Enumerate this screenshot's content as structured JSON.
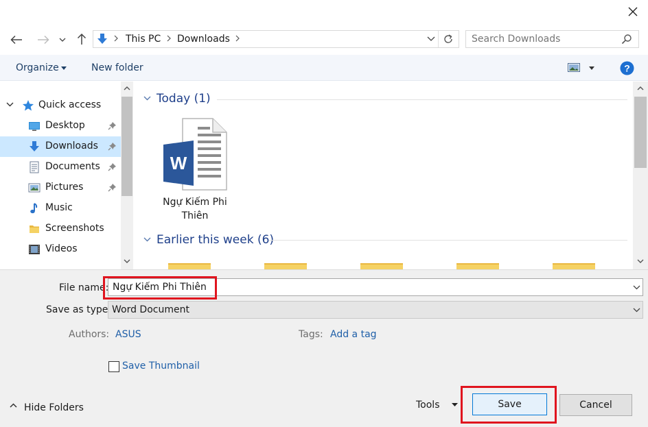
{
  "address_bar": {
    "breadcrumbs": [
      "This PC",
      "Downloads"
    ]
  },
  "search": {
    "placeholder": "Search Downloads"
  },
  "toolbar": {
    "organize_label": "Organize",
    "new_folder_label": "New folder"
  },
  "sidebar": {
    "items": [
      {
        "label": "Quick access",
        "icon": "star-icon"
      },
      {
        "label": "Desktop",
        "icon": "desktop-icon",
        "pinned": true
      },
      {
        "label": "Downloads",
        "icon": "download-arrow-icon",
        "pinned": true,
        "selected": true
      },
      {
        "label": "Documents",
        "icon": "documents-icon",
        "pinned": true
      },
      {
        "label": "Pictures",
        "icon": "pictures-icon",
        "pinned": true
      },
      {
        "label": "Music",
        "icon": "music-note-icon"
      },
      {
        "label": "Screenshots",
        "icon": "folder-icon"
      },
      {
        "label": "Videos",
        "icon": "film-icon"
      }
    ]
  },
  "content": {
    "groups": [
      {
        "title": "Today (1)",
        "files": [
          {
            "name": "Ngự Kiếm Phi Thiên",
            "icon": "word-document-icon"
          }
        ]
      },
      {
        "title": "Earlier this week (6)"
      }
    ]
  },
  "form": {
    "file_name_label": "File name:",
    "file_name_value": "Ngự Kiếm Phi Thiên",
    "save_as_type_label": "Save as type:",
    "save_as_type_value": "Word Document",
    "authors_label": "Authors:",
    "authors_value": "ASUS",
    "tags_label": "Tags:",
    "tags_value": "Add a tag",
    "save_thumbnail_label": "Save Thumbnail",
    "save_thumbnail_checked": false
  },
  "footer": {
    "hide_folders_label": "Hide Folders",
    "tools_label": "Tools",
    "save_label": "Save",
    "cancel_label": "Cancel"
  },
  "colors": {
    "accent": "#1e3f8a",
    "link": "#1f5fa8",
    "selection": "#cce8ff",
    "highlight_box": "#e0141e",
    "word_blue": "#2b579a",
    "folder_yellow": "#f5d264"
  }
}
